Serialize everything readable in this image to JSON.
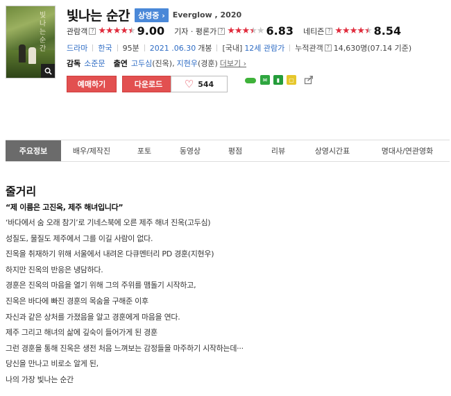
{
  "movie": {
    "title": "빛나는 순간",
    "status_badge": "상영중 ›",
    "eng_title": "Everglow , 2020"
  },
  "poster": {
    "text": "빛나는 순간",
    "zoom_icon": "search-icon"
  },
  "ratings": [
    {
      "label": "관람객",
      "help": "?",
      "score": "9.00",
      "stars": 4.5
    },
    {
      "label": "기자 · 평론가",
      "help": "?",
      "score": "6.83",
      "stars": 3.5
    },
    {
      "label": "네티즌",
      "help": "?",
      "score": "8.54",
      "stars": 4.5
    }
  ],
  "meta": {
    "genre": "드라마",
    "country": "한국",
    "runtime": "95분",
    "release_date": "2021 .06.30",
    "release_suffix": "개봉",
    "rating_prefix": "[국내]",
    "rating": "12세 관람가",
    "audience_label": "누적관객",
    "audience_help": "?",
    "audience_value": "14,630명(07.14 기준)"
  },
  "people": {
    "director_label": "감독",
    "director": "소준문",
    "cast_label": "출연",
    "cast_1": "고두심",
    "cast_1_role": "(진옥),",
    "cast_2": "지현우",
    "cast_2_role": "(경훈)",
    "more": "더보기 ›"
  },
  "buttons": {
    "book": "예매하기",
    "download": "다운로드",
    "like_count": "544"
  },
  "share_icons": [
    "line-icon",
    "band-icon",
    "bookmark-icon",
    "memo-icon",
    "share-out-icon"
  ],
  "tabs": [
    "주요정보",
    "배우/제작진",
    "포토",
    "동영상",
    "평점",
    "리뷰",
    "상영시간표",
    "명대사/연관영화"
  ],
  "synopsis": {
    "heading": "줄거리",
    "quote": "“제 이름은 고진옥, 제주 해녀입니다”",
    "lines": [
      "‘바다에서 숨 오래 참기’로 기네스북에 오른 제주 해녀 진옥(고두심)",
      " 성질도, 물질도 제주에서 그를 이길 사람이 없다.",
      " 진옥을 취재하기 위해 서울에서 내려온 다큐멘터리 PD 경훈(지현우)",
      " 하지만 진옥의 반응은 냉담하다.",
      " 경훈은 진옥의 마음을 열기 위해 그의 주위를 맴돌기 시작하고,",
      " 진옥은 바다에 빠진 경훈의 목숨을 구해준 이후",
      " 자신과 같은 상처를 가졌음을 알고 경훈에게 마음을 연다.",
      " 제주 그리고 해녀의 삶에 깊숙이 들어가게 된 경훈",
      " 그런 경훈을 통해 진옥은 생전 처음 느껴보는 감정들을 마주하기 시작하는데···",
      " 당신을 만나고 비로소 알게 된,",
      " 나의 가장 빛나는 순간"
    ]
  }
}
